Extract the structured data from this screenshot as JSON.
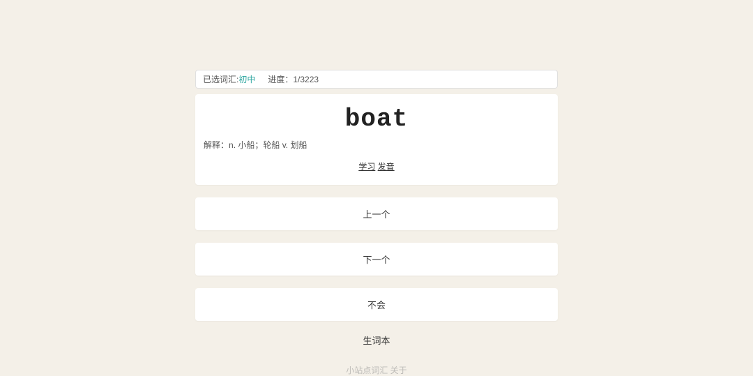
{
  "header": {
    "vocab_label": "已选词汇:",
    "vocab_value": "初中",
    "progress_label": "进度：",
    "progress_value": "1/3223"
  },
  "card": {
    "word": "boat",
    "definition_label": "解释：",
    "definition_value": "n. 小船；轮船 v. 划船",
    "study_link": "学习",
    "pronounce_link": "发音"
  },
  "buttons": {
    "prev": "上一个",
    "next": "下一个",
    "dont_know": "不会",
    "wordbook": "生词本"
  },
  "footer": {
    "text": "小站点词汇   关于"
  }
}
